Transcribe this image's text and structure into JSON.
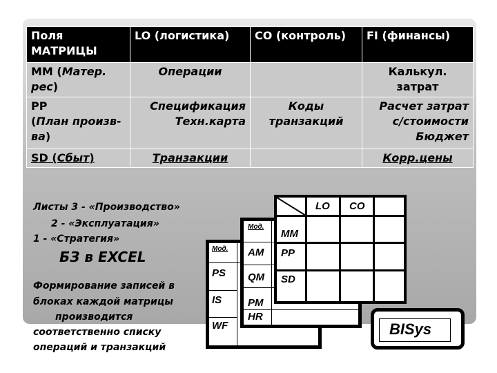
{
  "table": {
    "header": [
      "Поля МАТРИЦЫ",
      "LO (логистика)",
      "CO (контроль)",
      "FI (финансы)"
    ],
    "rows": [
      {
        "code": "MM",
        "name": "Матер. рес",
        "lo": "Операции",
        "co": "",
        "fi": "Калькул. затрат"
      },
      {
        "code": "PP",
        "name": "План произв-ва",
        "lo": "Спецификация Техн.карта",
        "co": "Коды транзакций",
        "fi": "Расчет затрат с/стоимости Бюджет"
      },
      {
        "code": "SD",
        "name": "Сбыт",
        "lo": "Транзакции",
        "co": "",
        "fi": "Корр.цены"
      }
    ]
  },
  "notes": {
    "line1": "Листы  3 - «Производство»",
    "line2": "2 - «Эксплуатация»",
    "line3": "1 - «Стратегия»",
    "title": "БЗ в  EXCEL",
    "para": [
      "Формирование записей в",
      "блоках каждой матрицы",
      "производится",
      "соответственно списку",
      "операций и транзакций"
    ]
  },
  "sheets": {
    "back": {
      "head": "Мод.",
      "rows": [
        "PS",
        "IS",
        "WF"
      ]
    },
    "middle": {
      "head": "Мод.",
      "rows": [
        "AM",
        "QM",
        "PM",
        "HR"
      ]
    },
    "front": {
      "cols": [
        "LO",
        "CO",
        ""
      ],
      "rows": [
        "MM",
        "PP",
        "SD"
      ]
    }
  },
  "brand": "BISys"
}
